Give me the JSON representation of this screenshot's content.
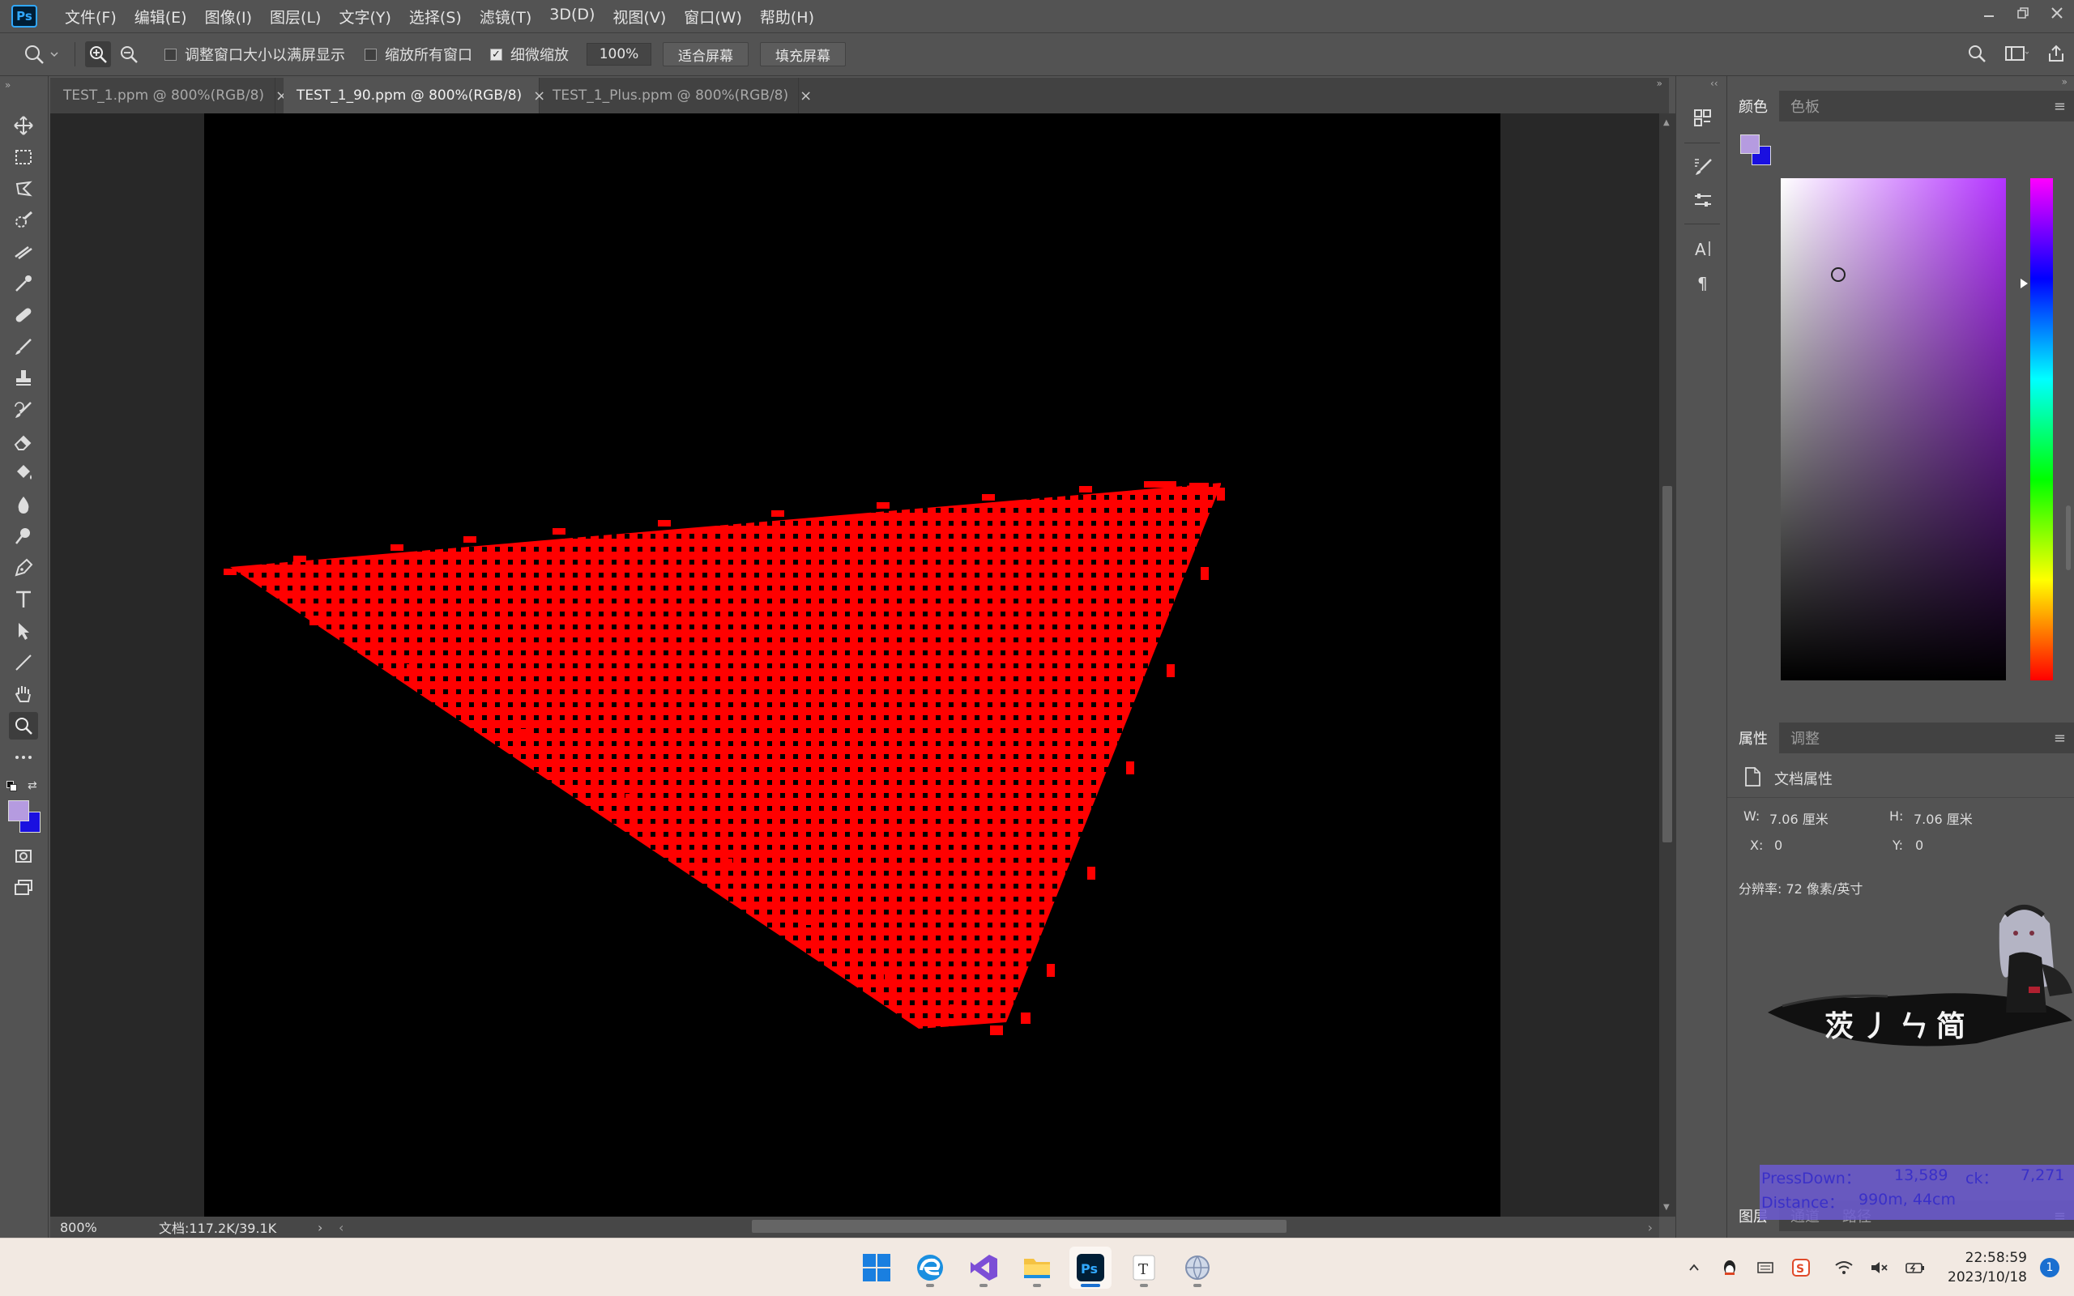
{
  "app": {
    "logo_text": "Ps"
  },
  "menu": [
    "文件(F)",
    "编辑(E)",
    "图像(I)",
    "图层(L)",
    "文字(Y)",
    "选择(S)",
    "滤镜(T)",
    "3D(D)",
    "视图(V)",
    "窗口(W)",
    "帮助(H)"
  ],
  "options": {
    "resize_windows_label": "调整窗口大小以满屏显示",
    "resize_windows_checked": false,
    "zoom_all_label": "缩放所有窗口",
    "zoom_all_checked": false,
    "scrubby_zoom_label": "细微缩放",
    "scrubby_zoom_checked": true,
    "zoom_value": "100%",
    "fit_screen_label": "适合屏幕",
    "fill_screen_label": "填充屏幕"
  },
  "tabs": [
    {
      "label": "TEST_1.ppm @ 800%(RGB/8)",
      "active": false
    },
    {
      "label": "TEST_1_90.ppm @ 800%(RGB/8)",
      "active": true
    },
    {
      "label": "TEST_1_Plus.ppm @ 800%(RGB/8)",
      "active": false
    }
  ],
  "tools": [
    "move-tool",
    "marquee-tool",
    "lasso-tool",
    "quick-select-tool",
    "crop-tool",
    "eyedropper-tool",
    "healing-brush-tool",
    "brush-tool",
    "stamp-tool",
    "history-brush-tool",
    "eraser-tool",
    "paint-bucket-tool",
    "blur-tool",
    "dodge-tool",
    "pen-tool",
    "type-tool",
    "path-select-tool",
    "line-tool",
    "hand-tool",
    "zoom-tool",
    "more-tools"
  ],
  "canvas": {
    "background": "#000000",
    "shape_color": "#ff0000"
  },
  "status": {
    "zoom": "800%",
    "doc_info": "文档:117.2K/39.1K"
  },
  "color_panel": {
    "tabs": [
      "颜色",
      "色板"
    ],
    "foreground": "#b59be0",
    "background": "#1a10e0"
  },
  "properties_panel": {
    "tabs": [
      "属性",
      "调整"
    ],
    "heading": "文档属性",
    "w_label": "W:",
    "w_value": "7.06 厘米",
    "h_label": "H:",
    "h_value": "7.06 厘米",
    "x_label": "X:",
    "x_value": "0",
    "y_label": "Y:",
    "y_value": "0",
    "resolution": "分辨率: 72 像素/英寸"
  },
  "layers_panel": {
    "tabs": [
      "图层",
      "通道",
      "路径"
    ]
  },
  "overlay": {
    "pressdown_label": "PressDown：",
    "pressdown_value": "13,589",
    "ck_label": "ck：",
    "ck_value": "7,271",
    "distance_label": "Distance：",
    "distance_value": "990m, 44cm"
  },
  "mascot": {
    "text": "茨丿ㄣ简"
  },
  "taskbar": {
    "apps": [
      "windows-start",
      "edge-browser",
      "visual-studio",
      "file-explorer",
      "photoshop",
      "typora",
      "network-app"
    ],
    "time": "22:58:59",
    "date": "2023/10/18",
    "notification_count": "1"
  }
}
